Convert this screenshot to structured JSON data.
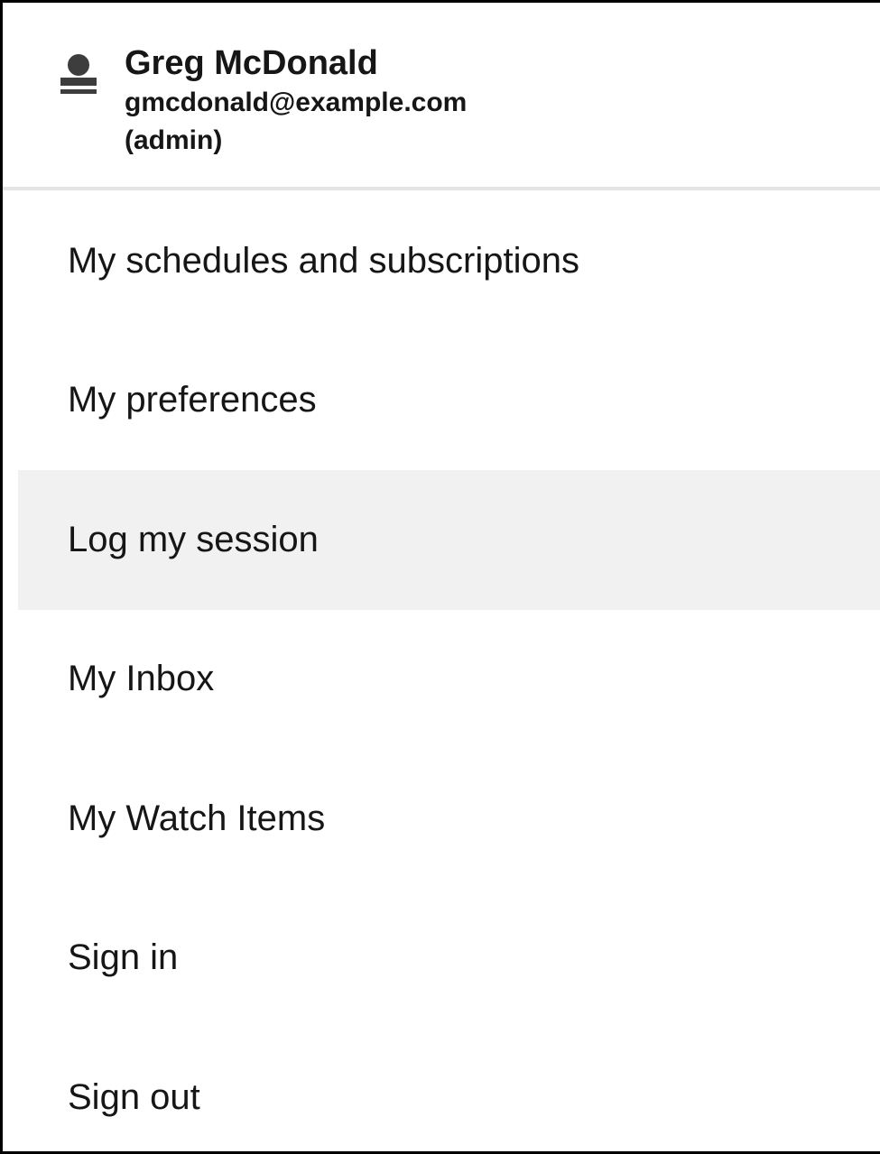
{
  "user": {
    "name": "Greg McDonald",
    "email": "gmcdonald@example.com",
    "role": "(admin)",
    "icon": "user-avatar-icon"
  },
  "menu": {
    "active_item": "Log my session",
    "hover_color": "#f1f1f1",
    "items": [
      {
        "label": "My schedules and subscriptions"
      },
      {
        "label": "My preferences"
      },
      {
        "label": "Log my session"
      },
      {
        "label": "My Inbox"
      },
      {
        "label": "My Watch Items"
      },
      {
        "label": "Sign in"
      },
      {
        "label": "Sign out"
      }
    ]
  }
}
